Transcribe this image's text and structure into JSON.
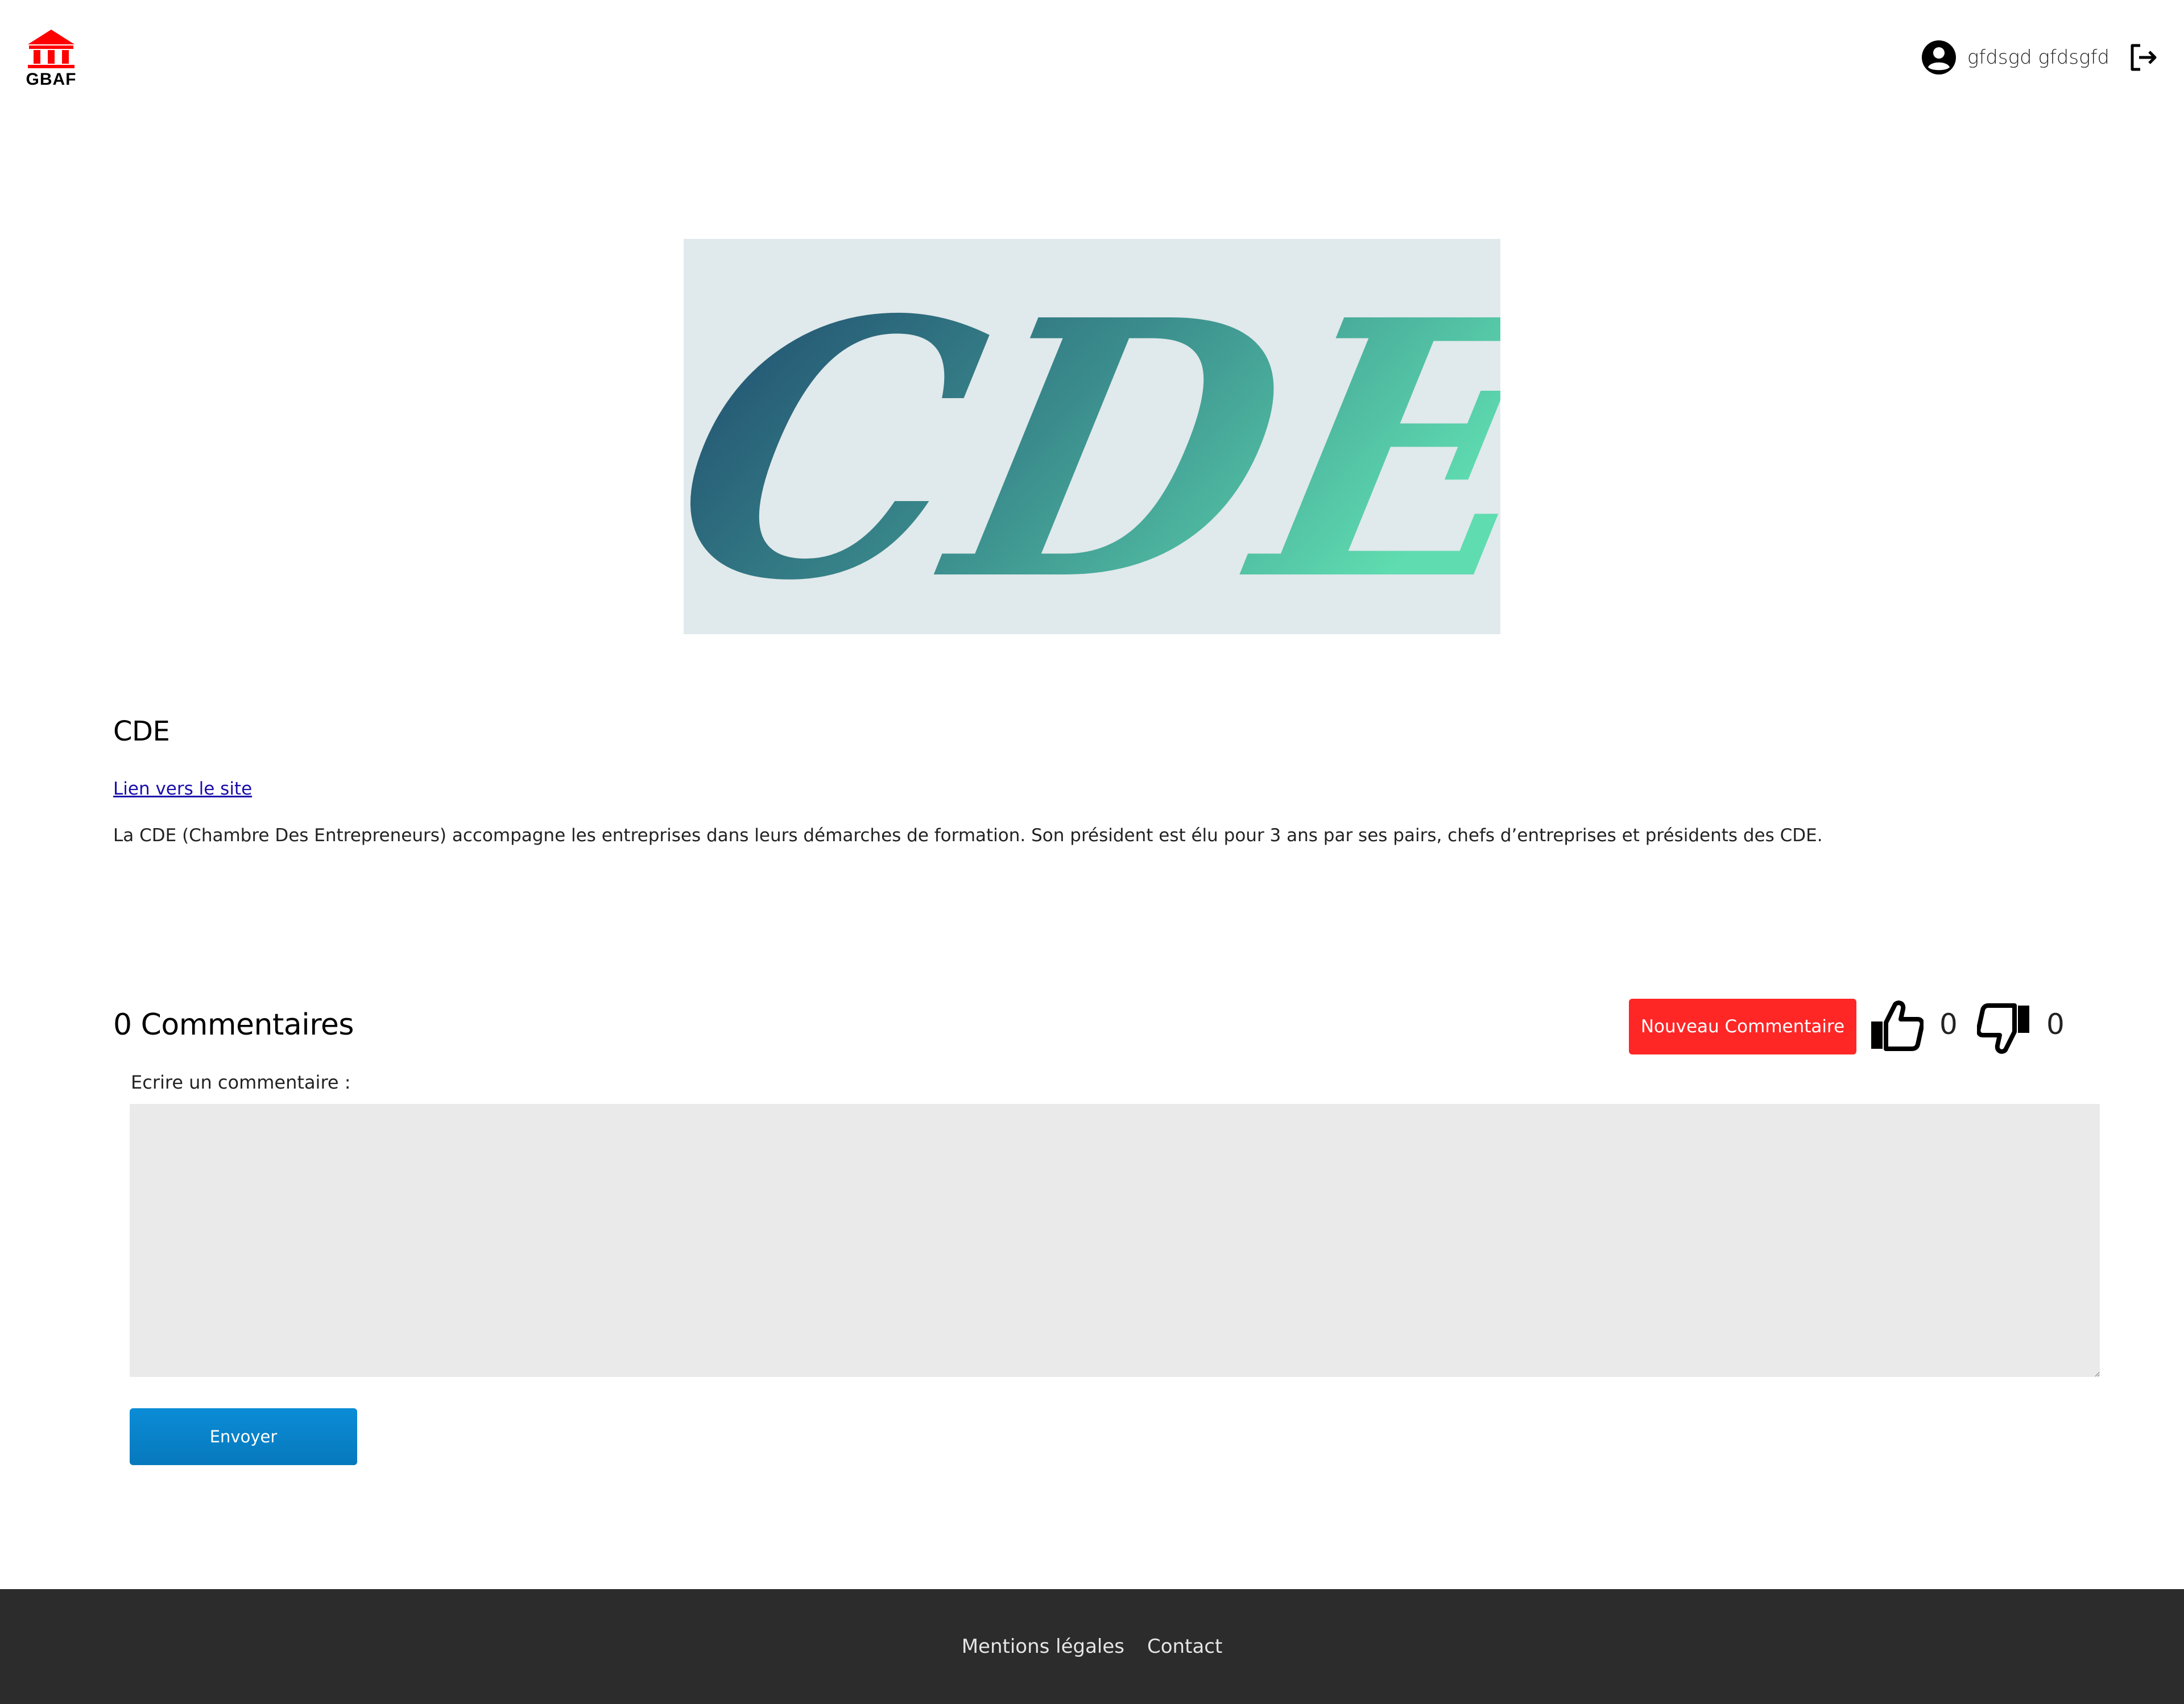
{
  "header": {
    "logo_text": "GBAF",
    "user_name": "gfdsgd gfdsgfd",
    "logo_color": "#ff0000"
  },
  "hero": {
    "logo_letters": "CDE",
    "background": "#e0e9eb",
    "gradient_start": "#1f4a6e",
    "gradient_end": "#5fdcb0"
  },
  "partner": {
    "name": "CDE",
    "link_label": "Lien vers le site",
    "description": "La CDE (Chambre Des Entrepreneurs) accompagne les entreprises dans leurs démarches de formation. Son président est élu pour 3 ans par ses pairs, chefs d’entreprises et présidents des CDE."
  },
  "comments": {
    "title": "0 Commentaires",
    "new_comment_label": "Nouveau Commentaire",
    "likes": "0",
    "dislikes": "0",
    "write_label": "Ecrire un commentaire :",
    "textarea_value": "",
    "send_label": "Envoyer",
    "accent_red": "#ff2626",
    "accent_blue": "#0b8cd6"
  },
  "footer": {
    "links": [
      "Mentions légales",
      "Contact"
    ]
  }
}
